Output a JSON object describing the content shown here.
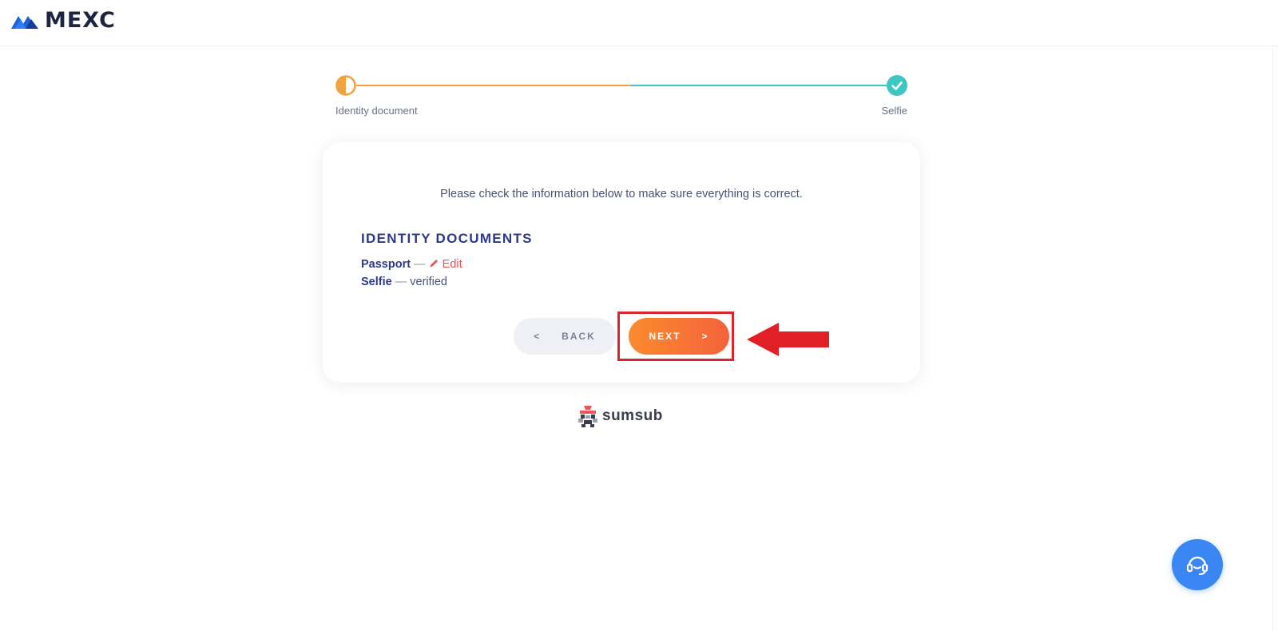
{
  "brand": {
    "name": "MEXC"
  },
  "stepper": {
    "steps": [
      {
        "label": "Identity document",
        "state": "in-progress"
      },
      {
        "label": "Selfie",
        "state": "completed"
      }
    ],
    "colors": {
      "active": "#f0a33b",
      "done": "#3ec7c2"
    }
  },
  "card": {
    "intro": "Please check the information below to make sure everything is correct.",
    "section_title": "IDENTITY DOCUMENTS",
    "documents": [
      {
        "name": "Passport",
        "separator": "—",
        "action": "Edit"
      },
      {
        "name": "Selfie",
        "separator": "—",
        "status": "verified"
      }
    ],
    "buttons": {
      "back": {
        "label": "BACK",
        "chevron": "<"
      },
      "next": {
        "label": "NEXT",
        "chevron": ">"
      }
    }
  },
  "footer": {
    "provider": "sumsub"
  },
  "support": {
    "icon": "headset-icon"
  },
  "annotation": {
    "color": "#d9262e"
  }
}
